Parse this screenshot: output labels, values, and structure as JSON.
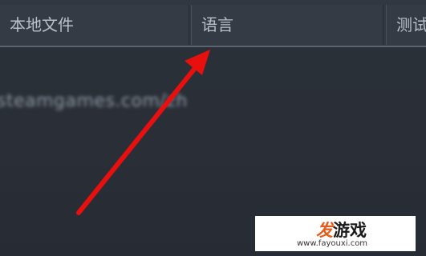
{
  "tabs": [
    {
      "label": "本地文件"
    },
    {
      "label": "语言"
    },
    {
      "label": "测试"
    }
  ],
  "blurred_url": "steamgames.com/zh",
  "annotation": {
    "type": "arrow",
    "color": "#e8100e",
    "points_to": "tab-language"
  },
  "watermark": {
    "logo_accent": "发",
    "logo_text": "游戏",
    "url": "www.fayouxi.com",
    "accent_color": "#e85a1c"
  }
}
